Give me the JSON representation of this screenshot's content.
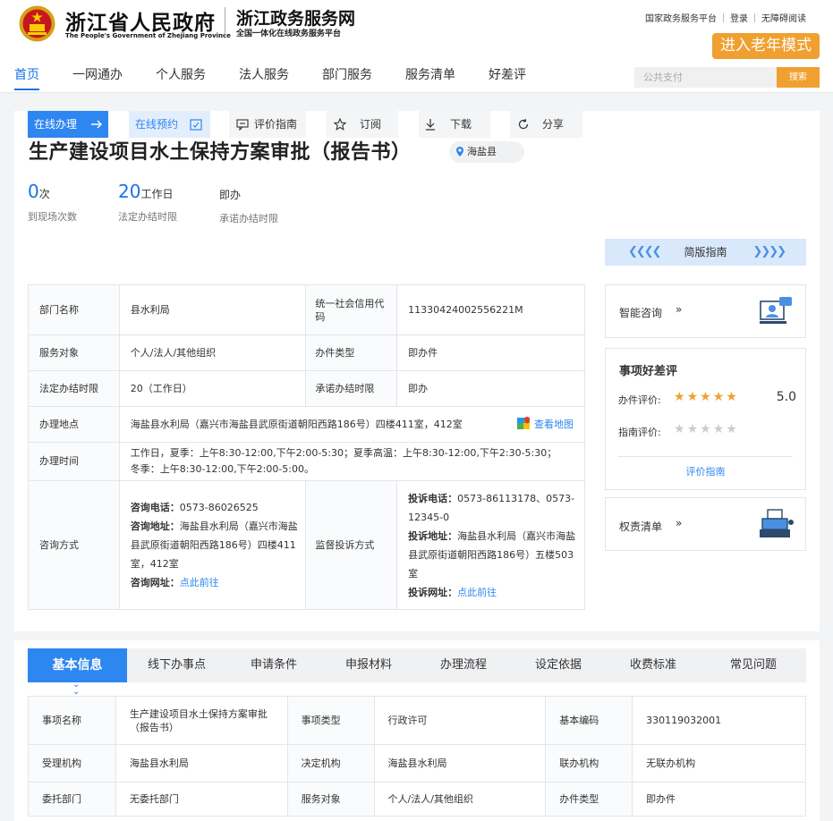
{
  "header": {
    "gov_name": "浙江省人民政府",
    "gov_en": "The People's Government of Zhejiang Province",
    "svc_name": "浙江政务服务网",
    "svc_sub": "全国一体化在线政务服务平台",
    "toplinks": [
      "国家政务服务平台",
      "登录",
      "无障碍阅读"
    ],
    "elder_mode": "进入老年模式",
    "nav": [
      "首页",
      "一网通办",
      "个人服务",
      "法人服务",
      "部门服务",
      "服务清单",
      "好差评"
    ],
    "search_placeholder": "公共支付",
    "search_btn": "搜索"
  },
  "item": {
    "title": "生产建设项目水土保持方案审批（报告书）",
    "location": "海盐县",
    "stats": [
      {
        "num": "0",
        "unit": "次",
        "label": "到现场次数"
      },
      {
        "num": "20",
        "unit": "工作日",
        "label": "法定办结时限"
      },
      {
        "num": "",
        "unit": "即办",
        "label": "承诺办结时限"
      }
    ],
    "actions": [
      "在线办理",
      "在线预约",
      "评价指南",
      "订阅",
      "下载",
      "分享"
    ],
    "simple_guide": "简版指南"
  },
  "info_table": {
    "dept_label": "部门名称",
    "dept": "县水利局",
    "credit_label": "统一社会信用代码",
    "credit": "11330424002556221M",
    "target_label": "服务对象",
    "target": "个人/法人/其他组织",
    "type_label": "办件类型",
    "type": "即办件",
    "legal_label": "法定办结时限",
    "legal": "20（工作日）",
    "promise_label": "承诺办结时限",
    "promise": "即办",
    "place_label": "办理地点",
    "place": "海盐县水利局（嘉兴市海盐县武原街道朝阳西路186号）四楼411室，412室",
    "map_link": "查看地图",
    "time_label": "办理时间",
    "time": "工作日，夏季：上午8:30-12:00,下午2:00-5:30；夏季高温：上午8:30-12:00,下午2:30-5:30；冬季：上午8:30-12:00,下午2:00-5:00。",
    "consult_label": "咨询方式",
    "consult_phone_k": "咨询电话：",
    "consult_phone": "0573-86026525",
    "consult_addr_k": "咨询地址：",
    "consult_addr": "海盐县水利局（嘉兴市海盐县武原街道朝阳西路186号）四楼411室，412室",
    "consult_web_k": "咨询网址：",
    "consult_web": "点此前往",
    "supervise_label": "监督投诉方式",
    "complain_phone_k": "投诉电话：",
    "complain_phone": "0573-86113178、0573-12345-0",
    "complain_addr_k": "投诉地址：",
    "complain_addr": "海盐县水利局（嘉兴市海盐县武原街道朝阳西路186号）五楼503室",
    "complain_web_k": "投诉网址：",
    "complain_web": "点此前往"
  },
  "side": {
    "smart": "智能咨询",
    "review_title": "事项好差评",
    "handle_rating_label": "办件评价:",
    "handle_rating_value": "5.0",
    "handle_stars": 5,
    "guide_rating_label": "指南评价:",
    "guide_stars": 0,
    "review_guide_link": "评价指南",
    "power_list": "权责清单"
  },
  "tabs": [
    "基本信息",
    "线下办事点",
    "申请条件",
    "申报材料",
    "办理流程",
    "设定依据",
    "收费标准",
    "常见问题"
  ],
  "basic_table": {
    "rows": [
      [
        "事项名称",
        "生产建设项目水土保持方案审批（报告书）",
        "事项类型",
        "行政许可",
        "基本编码",
        "330119032001"
      ],
      [
        "受理机构",
        "海盐县水利局",
        "决定机构",
        "海盐县水利局",
        "联办机构",
        "无联办机构"
      ],
      [
        "委托部门",
        "无委托部门",
        "服务对象",
        "个人/法人/其他组织",
        "办件类型",
        "即办件"
      ]
    ]
  },
  "colors": {
    "accent": "#2e86f0",
    "orange": "#f0a030",
    "star": "#f0a030"
  }
}
